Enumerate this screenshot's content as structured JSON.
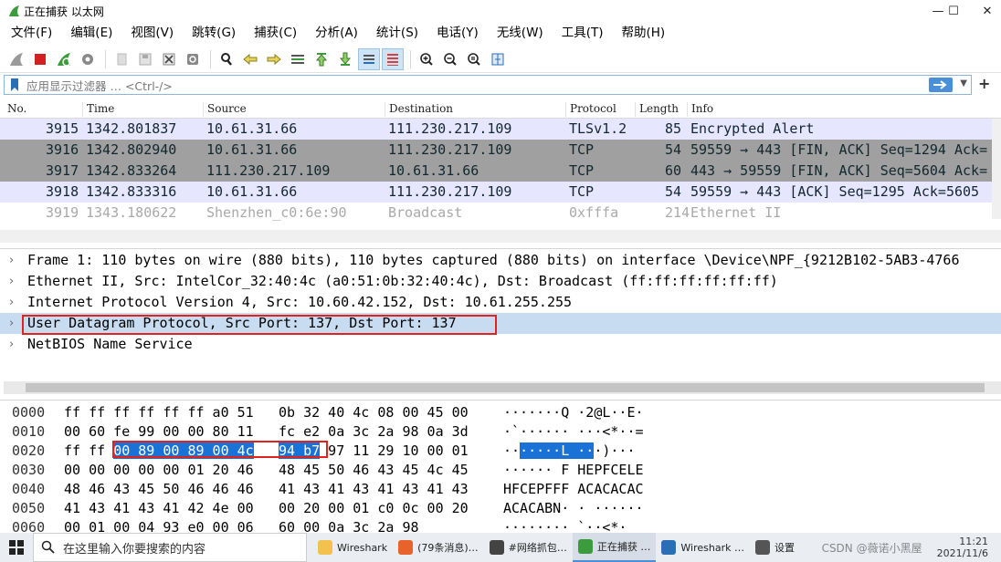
{
  "window": {
    "title": "正在捕获 以太网",
    "minimize": "—",
    "maximize": "☐",
    "close": "✕"
  },
  "menu": [
    "文件(F)",
    "编辑(E)",
    "视图(V)",
    "跳转(G)",
    "捕获(C)",
    "分析(A)",
    "统计(S)",
    "电话(Y)",
    "无线(W)",
    "工具(T)",
    "帮助(H)"
  ],
  "filter": {
    "placeholder": "应用显示过滤器 … <Ctrl-/>"
  },
  "packet_list": {
    "columns": [
      "No.",
      "Time",
      "Source",
      "Destination",
      "Protocol",
      "Length",
      "Info"
    ],
    "rows": [
      {
        "no": "3915",
        "time": "1342.801837",
        "src": "10.61.31.66",
        "dst": "111.230.217.109",
        "proto": "TLSv1.2",
        "len": "85",
        "info": "Encrypted Alert",
        "bg": "#e7e6ff",
        "fg": "#12272e"
      },
      {
        "no": "3916",
        "time": "1342.802940",
        "src": "10.61.31.66",
        "dst": "111.230.217.109",
        "proto": "TCP",
        "len": "54",
        "info": "59559 → 443 [FIN, ACK] Seq=1294 Ack=",
        "bg": "#a0a0a0",
        "fg": "#12272e"
      },
      {
        "no": "3917",
        "time": "1342.833264",
        "src": "111.230.217.109",
        "dst": "10.61.31.66",
        "proto": "TCP",
        "len": "60",
        "info": "443 → 59559 [FIN, ACK] Seq=5604 Ack=",
        "bg": "#a0a0a0",
        "fg": "#12272e"
      },
      {
        "no": "3918",
        "time": "1342.833316",
        "src": "10.61.31.66",
        "dst": "111.230.217.109",
        "proto": "TCP",
        "len": "54",
        "info": "59559 → 443 [ACK] Seq=1295 Ack=5605",
        "bg": "#e7e6ff",
        "fg": "#12272e"
      },
      {
        "no": "3919",
        "time": "1343.180622",
        "src": "Shenzhen_c0:6e:90",
        "dst": "Broadcast",
        "proto": "0xfffa",
        "len": "214",
        "info": "Ethernet II",
        "bg": "#ffffff",
        "fg": "#a9a9a9"
      }
    ]
  },
  "details": {
    "rows": [
      {
        "arrow": "›",
        "text": "Frame 1: 110 bytes on wire (880 bits), 110 bytes captured (880 bits) on interface \\Device\\NPF_{9212B102-5AB3-4766"
      },
      {
        "arrow": "›",
        "text": "Ethernet II, Src: IntelCor_32:40:4c (a0:51:0b:32:40:4c), Dst: Broadcast (ff:ff:ff:ff:ff:ff)"
      },
      {
        "arrow": "›",
        "text": "Internet Protocol Version 4, Src: 10.60.42.152, Dst: 10.61.255.255"
      },
      {
        "arrow": "›",
        "text": "User Datagram Protocol, Src Port: 137, Dst Port: 137"
      },
      {
        "arrow": "›",
        "text": "NetBIOS Name Service"
      }
    ],
    "selected_index": 3
  },
  "hex": {
    "rows": [
      {
        "off": "0000",
        "b1": "ff ff ff ff ff ff a0 51",
        "b2": "0b 32 40 4c 08 00 45 00",
        "asc": "·······Q ·2@L··E·"
      },
      {
        "off": "0010",
        "b1": "00 60 fe 99 00 00 80 11",
        "b2": "fc e2 0a 3c 2a 98 0a 3d",
        "asc": "·`······ ···<*··="
      },
      {
        "off": "0020",
        "b1": "ff ff ",
        "b1hi": "00 89 00 89 00 4c",
        "b2hi": "94 b7",
        "b2": " 97 11 29 10 00 01",
        "asc_pre": "··",
        "asc_hi": "·····L ··",
        "asc": "·)···"
      },
      {
        "off": "0030",
        "b1": "00 00 00 00 00 01 20 46",
        "b2": "48 45 50 46 43 45 4c 45",
        "asc": "······ F HEPFCELE"
      },
      {
        "off": "0040",
        "b1": "48 46 43 45 50 46 46 46",
        "b2": "41 43 41 43 41 43 41 43",
        "asc": "HFCEPFFF ACACACAC"
      },
      {
        "off": "0050",
        "b1": "41 43 41 43 41 42 4e 00",
        "b2": "00 20 00 01 c0 0c 00 20",
        "asc": "ACACABN· · ······"
      },
      {
        "off": "0060",
        "b1": "00 01 00 04 93 e0 00 06",
        "b2": "60 00 0a 3c 2a 98",
        "asc": "········ `··<*·"
      }
    ]
  },
  "taskbar": {
    "search_placeholder": "在这里输入你要搜索的内容",
    "tasks": [
      {
        "label": "Wireshark",
        "color": "#f2c14e",
        "active": false
      },
      {
        "label": "(79条消息)…",
        "color": "#e8622c",
        "active": false
      },
      {
        "label": "#网络抓包…",
        "color": "#444444",
        "active": false
      },
      {
        "label": "正在捕获 …",
        "color": "#3c9b3c",
        "active": true
      },
      {
        "label": "Wireshark …",
        "color": "#2a6fb5",
        "active": false
      },
      {
        "label": "设置",
        "color": "#555555",
        "active": false
      }
    ],
    "tray_text": "CSDN @薇诺小黑屋",
    "time": "11:21",
    "date": "2021/11/6"
  }
}
